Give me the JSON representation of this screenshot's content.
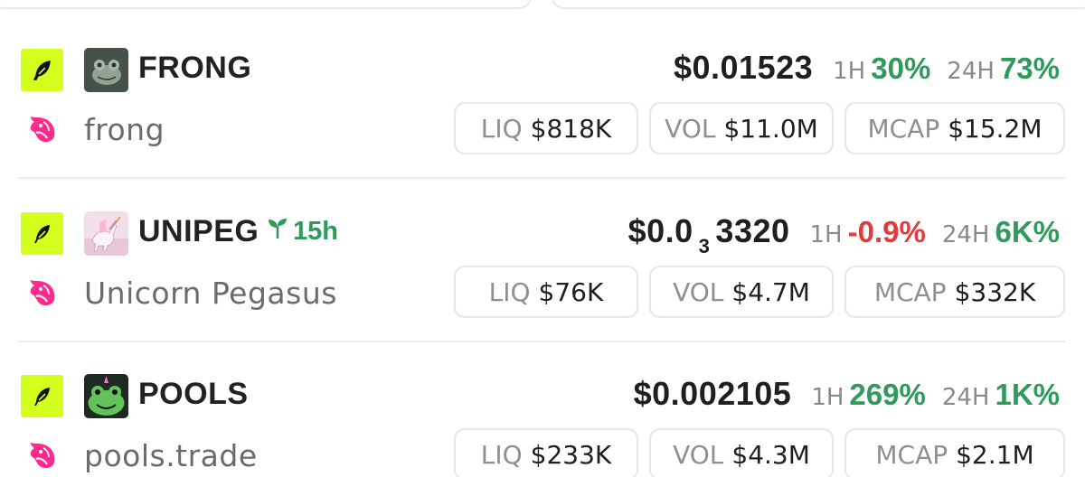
{
  "tokens": [
    {
      "symbol": "FRONG",
      "name": "frong",
      "age": "",
      "price": {
        "prefix": "$0.01523",
        "subscript": "",
        "suffix": ""
      },
      "change_1h": {
        "label": "1H",
        "value": "30%",
        "direction": "up"
      },
      "change_24h": {
        "label": "24H",
        "value": "73%",
        "direction": "up"
      },
      "liq": {
        "label": "LIQ",
        "value": "$818K"
      },
      "vol": {
        "label": "VOL",
        "value": "$11.0M"
      },
      "mcap": {
        "label": "MCAP",
        "value": "$15.2M"
      },
      "avatar_icon": "frog-photo-icon"
    },
    {
      "symbol": "UNIPEG",
      "name": "Unicorn Pegasus",
      "age": "15h",
      "price": {
        "prefix": "$0.0",
        "subscript": "3",
        "suffix": "3320"
      },
      "change_1h": {
        "label": "1H",
        "value": "-0.9%",
        "direction": "down"
      },
      "change_24h": {
        "label": "24H",
        "value": "6K%",
        "direction": "up"
      },
      "liq": {
        "label": "LIQ",
        "value": "$76K"
      },
      "vol": {
        "label": "VOL",
        "value": "$4.7M"
      },
      "mcap": {
        "label": "MCAP",
        "value": "$332K"
      },
      "avatar_icon": "pegasus-icon"
    },
    {
      "symbol": "POOLS",
      "name": "pools.trade",
      "age": "",
      "price": {
        "prefix": "$0.002105",
        "subscript": "",
        "suffix": ""
      },
      "change_1h": {
        "label": "1H",
        "value": "269%",
        "direction": "up"
      },
      "change_24h": {
        "label": "24H",
        "value": "1K%",
        "direction": "up"
      },
      "liq": {
        "label": "LIQ",
        "value": "$233K"
      },
      "vol": {
        "label": "VOL",
        "value": "$4.3M"
      },
      "mcap": {
        "label": "MCAP",
        "value": "$2.1M"
      },
      "avatar_icon": "frog-unicorn-icon"
    }
  ],
  "colors": {
    "chain_badge": "#d4ff1e",
    "positive": "#2e9a5c",
    "negative": "#e23b3b",
    "uniswap_pink": "#ff2a8a"
  },
  "icons": {
    "chain": "feather-icon",
    "dex": "uniswap-unicorn-icon",
    "age": "seedling-icon"
  }
}
